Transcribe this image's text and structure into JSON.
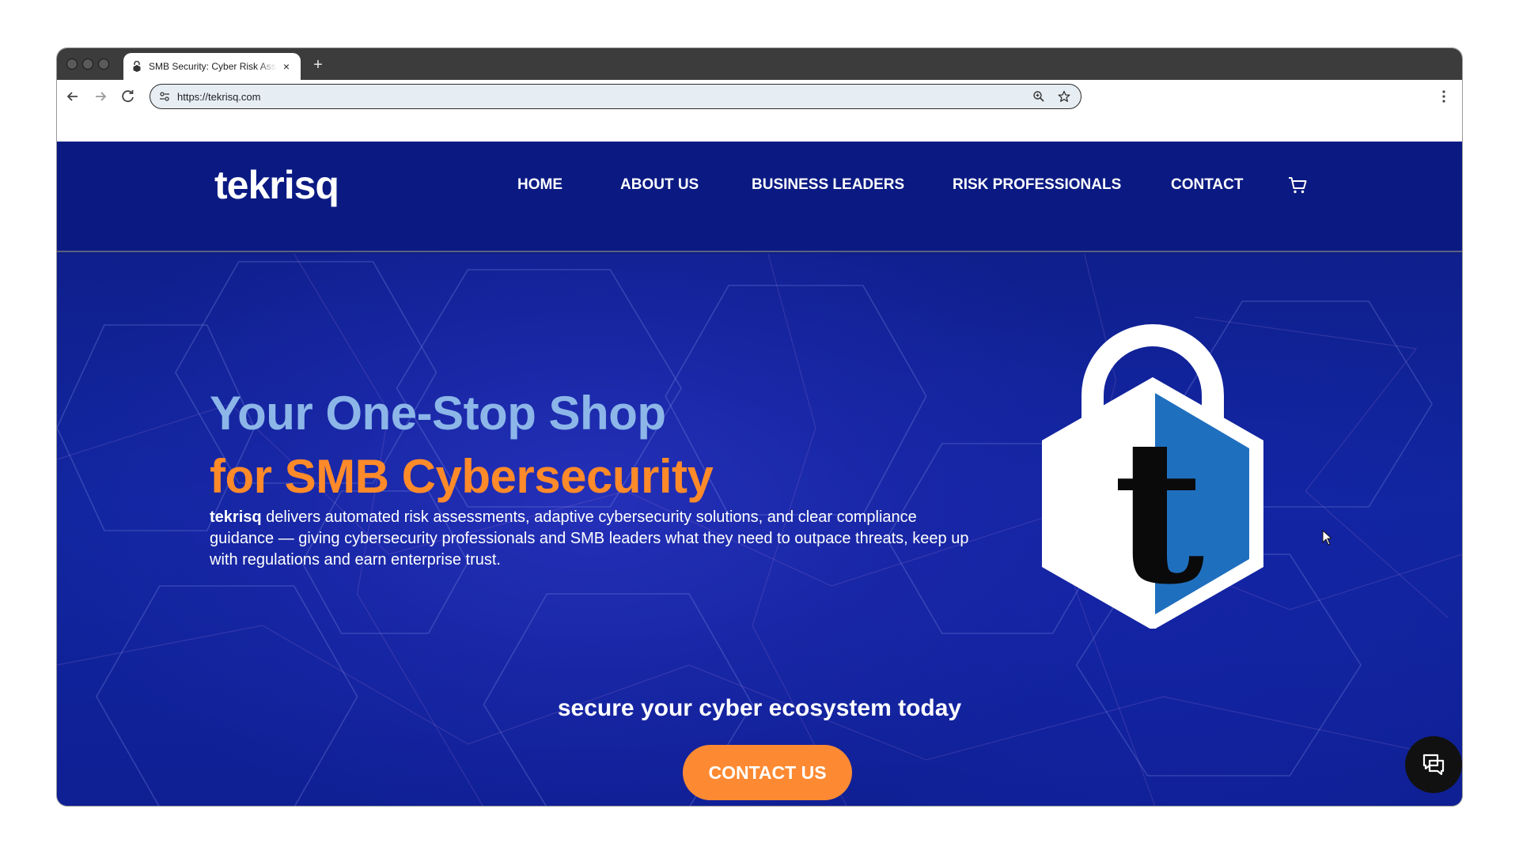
{
  "browser": {
    "tab_title": "SMB Security: Cyber Risk Assessment",
    "tab_close_label": "×",
    "new_tab_label": "+",
    "url": "https://tekrisq.com",
    "icons": [
      "back-arrow-icon",
      "forward-arrow-icon",
      "reload-icon",
      "site-settings-icon",
      "zoom-icon",
      "bookmark-star-icon",
      "menu-dots-icon"
    ]
  },
  "site": {
    "logo_text": "tekrisq",
    "nav": [
      "HOME",
      "ABOUT US",
      "BUSINESS LEADERS",
      "RISK PROFESSIONALS",
      "CONTACT"
    ],
    "hero": {
      "headline_line1": "Your One-Stop Shop",
      "headline_line2": "for SMB Cybersecurity",
      "intro_brand": "tekrisq",
      "intro_text": " delivers automated risk assessments, adaptive cybersecurity solutions, and clear compliance guidance — giving cybersecurity professionals and SMB leaders what they need to outpace threats, keep up with regulations and earn enterprise trust.",
      "lock_letter": "t",
      "tagline": "secure your cyber ecosystem today",
      "cta_label": "CONTACT US"
    }
  },
  "colors": {
    "header_bg": "#0b1a82",
    "hero_bg": "#1126a0",
    "headline_blue": "#8cb6e8",
    "headline_orange": "#ff8a2a",
    "cta_orange": "#fd8a33",
    "lock_blue": "#1f6fbf"
  }
}
